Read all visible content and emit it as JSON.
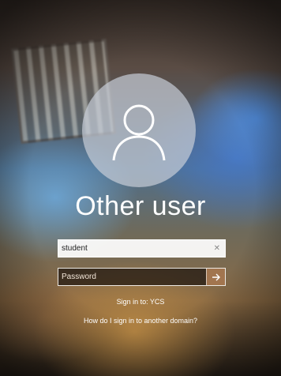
{
  "login": {
    "title": "Other user",
    "username_value": "student",
    "password_placeholder": "Password",
    "sign_in_to": "Sign in to: YCS",
    "another_domain_link": "How do I sign in to another domain?"
  },
  "icons": {
    "avatar": "user-silhouette-icon",
    "clear": "clear-x-icon",
    "submit": "arrow-right-icon"
  },
  "colors": {
    "text": "#ffffff",
    "avatar_circle": "#c8cdd7"
  }
}
